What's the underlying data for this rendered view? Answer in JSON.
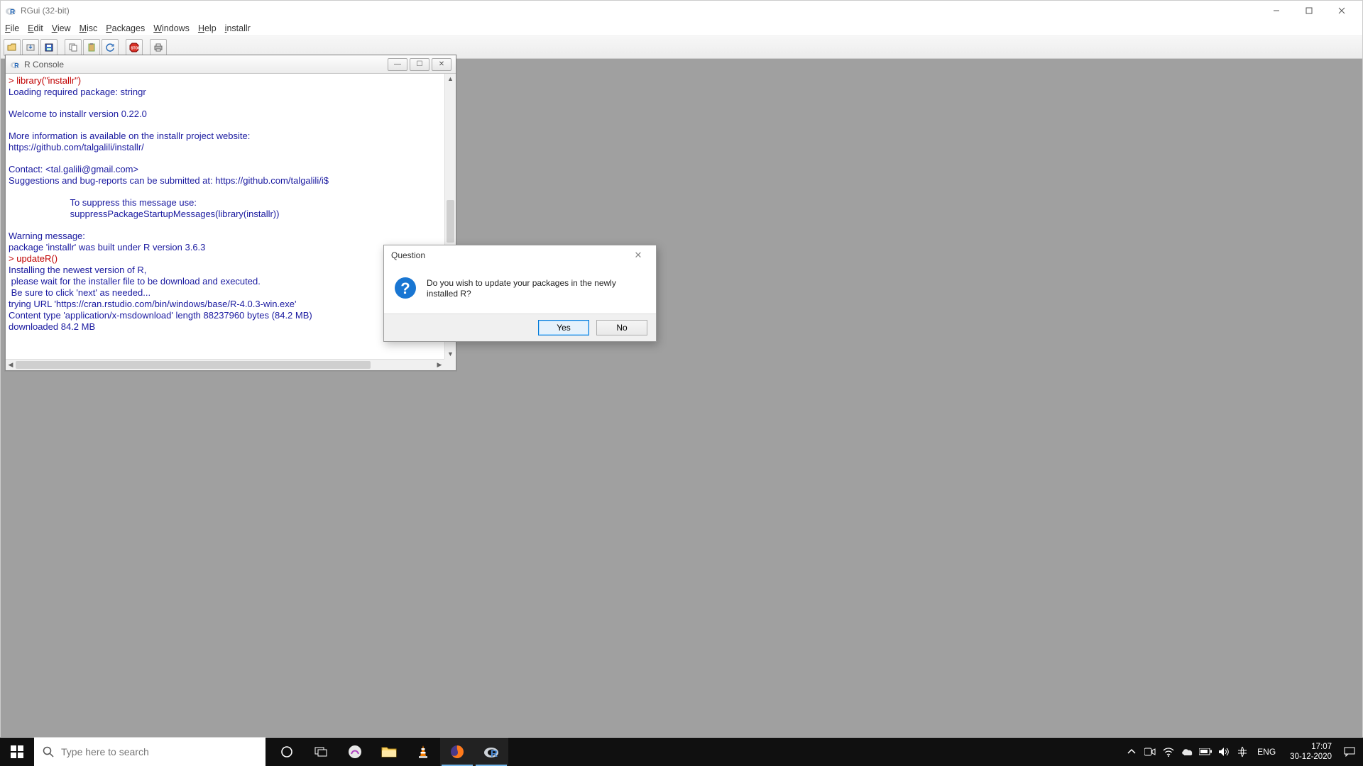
{
  "app": {
    "title": "RGui (32-bit)"
  },
  "menu": {
    "file": "File",
    "edit": "Edit",
    "view": "View",
    "misc": "Misc",
    "packages": "Packages",
    "windows": "Windows",
    "help": "Help",
    "installr": "installr"
  },
  "toolbar_icons": [
    "open",
    "load-workspace",
    "save",
    "copy",
    "paste",
    "refresh",
    "stop",
    "print"
  ],
  "console": {
    "title": "R Console",
    "prompt": "> ",
    "cmd1": "library(\"installr\")",
    "out1": "Loading required package: stringr",
    "out2": "Welcome to installr version 0.22.0",
    "out3": "More information is available on the installr project website:",
    "out4": "https://github.com/talgalili/installr/",
    "out5": "Contact: <tal.galili@gmail.com>",
    "out6": "Suggestions and bug-reports can be submitted at: https://github.com/talgalili/i$",
    "out7": "                        To suppress this message use:",
    "out8": "                        suppressPackageStartupMessages(library(installr))",
    "out9": "Warning message:",
    "out10": "package 'installr' was built under R version 3.6.3",
    "cmd2": "updateR()",
    "out11": "Installing the newest version of R,",
    "out12": " please wait for the installer file to be download and executed.",
    "out13": " Be sure to click 'next' as needed...",
    "out14": "trying URL 'https://cran.rstudio.com/bin/windows/base/R-4.0.3-win.exe'",
    "out15": "Content type 'application/x-msdownload' length 88237960 bytes (84.2 MB)",
    "out16": "downloaded 84.2 MB"
  },
  "dialog": {
    "title": "Question",
    "message": "Do you wish to update your packages in the newly installed R?",
    "yes": "Yes",
    "no": "No"
  },
  "taskbar": {
    "search_placeholder": "Type here to search",
    "lang": "ENG",
    "time": "17:07",
    "date": "30-12-2020"
  }
}
